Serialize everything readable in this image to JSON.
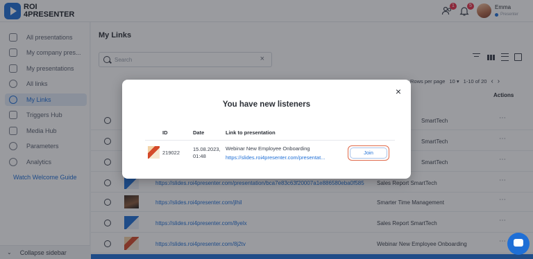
{
  "header": {
    "logo_line1": "ROI",
    "logo_line2": "4PRESENTER",
    "listeners_count": "1",
    "notifications_count": "5",
    "user_name": "Emma",
    "user_status": "Presenter"
  },
  "sidebar": {
    "items": [
      {
        "label": "All presentations",
        "icon": "monitor-icon"
      },
      {
        "label": "My company pres...",
        "icon": "presentation-icon"
      },
      {
        "label": "My presentations",
        "icon": "presentation-user-icon"
      },
      {
        "label": "All links",
        "icon": "link-icon"
      },
      {
        "label": "My Links",
        "icon": "link-icon"
      },
      {
        "label": "Triggers Hub",
        "icon": "lightning-icon"
      },
      {
        "label": "Media Hub",
        "icon": "media-icon"
      },
      {
        "label": "Parameters",
        "icon": "parameters-icon"
      },
      {
        "label": "Analytics",
        "icon": "analytics-icon"
      }
    ],
    "active_index": 4,
    "welcome_guide": "Watch Welcome Guide",
    "collapse_label": "Collapse sidebar"
  },
  "main": {
    "title": "My Links",
    "search_placeholder": "Search",
    "rows_per_page_label": "Rows per page",
    "rows_per_page_value": "10",
    "range": "1-10 of 20",
    "actions_header": "Actions",
    "rows": [
      {
        "url": "",
        "presentation": "SmartTech"
      },
      {
        "url": "",
        "presentation": "SmartTech"
      },
      {
        "url": "",
        "presentation": "SmartTech"
      },
      {
        "url": "https://slides.roi4presenter.com/presentation/bca7e83c63f20007a1e886580eba0f585",
        "presentation": "Sales Report SmartTech"
      },
      {
        "url": "https://slides.roi4presenter.com/jlhil",
        "presentation": "Smarter Time Management"
      },
      {
        "url": "https://slides.roi4presenter.com/8yelx",
        "presentation": "Sales Report SmartTech"
      },
      {
        "url": "https://slides.roi4presenter.com/8j2tv",
        "presentation": "Webinar New Employee Onboarding"
      }
    ]
  },
  "modal": {
    "title": "You have new listeners",
    "col_id": "ID",
    "col_date": "Date",
    "col_link": "Link to presentation",
    "row": {
      "id": "219022",
      "date_line1": "15.08.2023,",
      "date_line2": "01:48",
      "presentation_name": "Webinar New Employee Onboarding",
      "url": "https://slides.roi4presenter.com/presentat...",
      "join_label": "Join"
    },
    "close_symbol": "×"
  },
  "colors": {
    "accent": "#1f6fd6",
    "join_highlight": "#e06a4b",
    "badge": "#e5304a"
  }
}
